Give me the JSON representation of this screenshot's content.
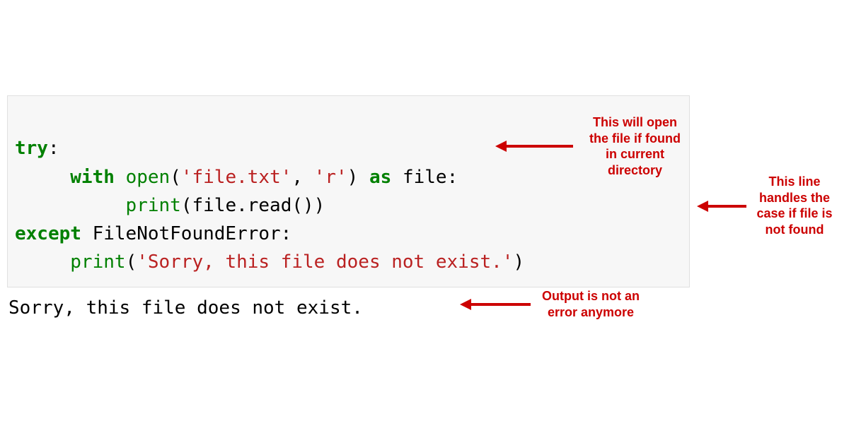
{
  "code": {
    "try_kw": "try",
    "colon": ":",
    "with_kw": "with",
    "open_fn": "open",
    "lparen": "(",
    "str_file": "'file.txt'",
    "comma": ", ",
    "str_mode": "'r'",
    "rparen": ")",
    "as_kw": "as",
    "file_var": " file:",
    "print1": "print",
    "file_read": "(file.read())",
    "except_kw": "except",
    "exc_name": " FileNotFoundError:",
    "print2": "print",
    "str_sorry": "'Sorry, this file does not exist.'",
    "rparen2": ")"
  },
  "output": "Sorry, this file does not exist.",
  "annotations": {
    "a1": "This will open\nthe file if found\nin current\ndirectory",
    "a2": "This line\nhandles the\ncase if file is\nnot found",
    "a3": "Output is not an\nerror anymore"
  },
  "colors": {
    "annotation": "#cc0000",
    "code_bg": "#f7f7f7",
    "keyword": "#008000",
    "string": "#ba2121"
  }
}
